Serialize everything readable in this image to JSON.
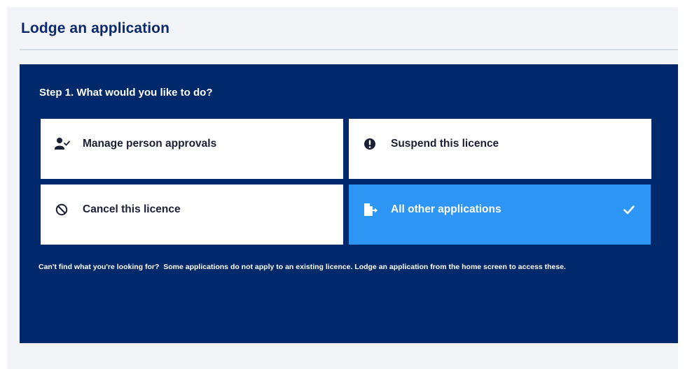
{
  "page": {
    "title": "Lodge an application"
  },
  "step": {
    "title": "Step 1. What would you like to do?",
    "options": [
      {
        "label": "Manage person approvals",
        "icon": "person-check-icon",
        "selected": false
      },
      {
        "label": "Suspend this licence",
        "icon": "exclamation-circle-icon",
        "selected": false
      },
      {
        "label": "Cancel this licence",
        "icon": "ban-icon",
        "selected": false
      },
      {
        "label": "All other applications",
        "icon": "document-arrow-icon",
        "selected": true
      }
    ]
  },
  "help": {
    "lead": "Can't find what you're looking for?",
    "text": "Some applications do not apply to an existing licence. Lodge an application from the home screen to access these."
  },
  "colors": {
    "panel": "#00296b",
    "heading": "#0b2a6e",
    "selected": "#2d95f4",
    "page_bg": "#f3f4f8"
  }
}
